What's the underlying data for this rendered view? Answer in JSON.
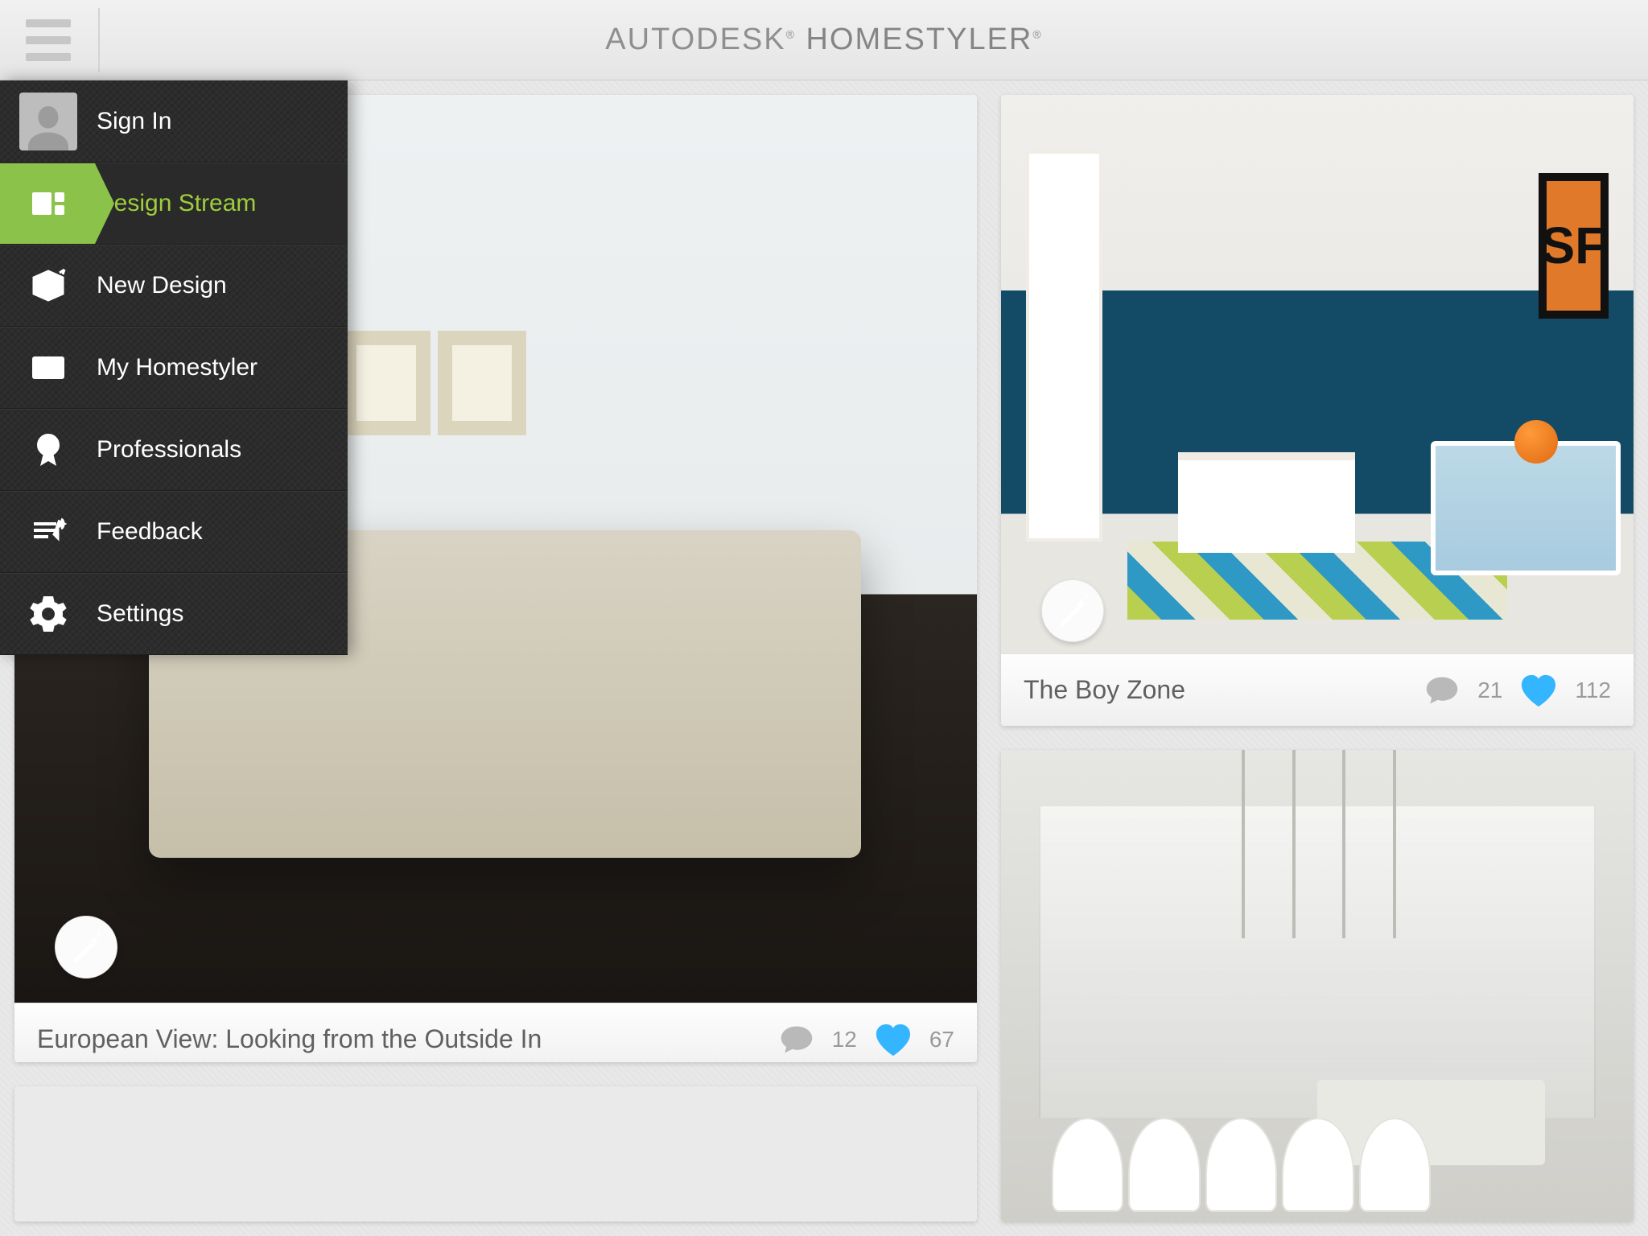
{
  "header": {
    "brand_prefix": "AUTODESK",
    "brand_name": "HOMESTYLER"
  },
  "sidebar": {
    "items": [
      {
        "label": "Sign In",
        "icon": "avatar"
      },
      {
        "label": "Design Stream",
        "icon": "stream",
        "active": true
      },
      {
        "label": "New Design",
        "icon": "box"
      },
      {
        "label": "My Homestyler",
        "icon": "idcard"
      },
      {
        "label": "Professionals",
        "icon": "award"
      },
      {
        "label": "Feedback",
        "icon": "feedback"
      },
      {
        "label": "Settings",
        "icon": "gear"
      }
    ]
  },
  "cards": {
    "large": {
      "title": "European View: Looking from the Outside In",
      "comments": "12",
      "likes": "67"
    },
    "boy": {
      "title": "The Boy Zone",
      "comments": "21",
      "likes": "112",
      "poster_text": "SF"
    }
  },
  "colors": {
    "accent_green": "#8bc34a",
    "like_blue": "#33b5ff"
  }
}
